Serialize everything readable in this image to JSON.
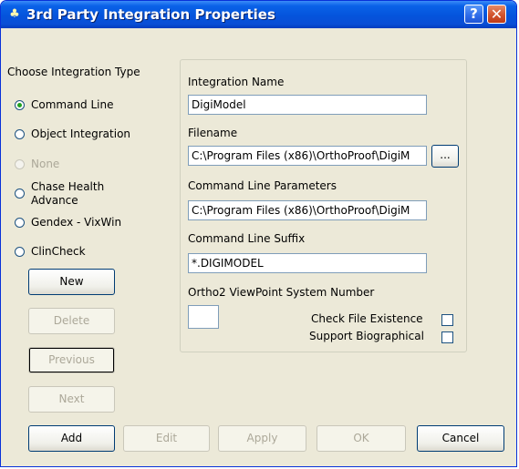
{
  "window": {
    "title": "3rd Party Integration Properties",
    "help_symbol": "?",
    "close_symbol": "✕",
    "title_icon": "integration-app-icon"
  },
  "integration_type": {
    "label": "Choose Integration Type",
    "options": [
      {
        "label": "Command Line",
        "checked": true,
        "enabled": true
      },
      {
        "label": "Object Integration",
        "checked": false,
        "enabled": true
      },
      {
        "label": "None",
        "checked": false,
        "enabled": false
      },
      {
        "label": "Chase Health\nAdvance",
        "line1": "Chase Health",
        "line2": "Advance",
        "checked": false,
        "enabled": true
      },
      {
        "label": "Gendex - VixWin",
        "checked": false,
        "enabled": true
      },
      {
        "label": "ClinCheck",
        "checked": false,
        "enabled": true
      }
    ]
  },
  "side_buttons": {
    "new": "New",
    "delete": "Delete",
    "previous": "Previous",
    "next": "Next"
  },
  "details": {
    "integration_name_label": "Integration Name",
    "integration_name_value": "DigiModel",
    "filename_label": "Filename",
    "filename_value": "C:\\Program Files (x86)\\OrthoProof\\DigiM",
    "browse_label": "...",
    "params_label": "Command Line Parameters",
    "params_value": "C:\\Program Files (x86)\\OrthoProof\\DigiM",
    "suffix_label": "Command Line Suffix",
    "suffix_value": "*.DIGIMODEL",
    "viewpoint_label": "Ortho2 ViewPoint System Number",
    "viewpoint_value": "",
    "check_file_label": "Check File Existence",
    "check_file_checked": false,
    "support_bio_label": "Support Biographical",
    "support_bio_checked": false
  },
  "bottom_buttons": {
    "add": "Add",
    "edit": "Edit",
    "apply": "Apply",
    "ok": "OK",
    "cancel": "Cancel"
  },
  "colors": {
    "titlebar": "#0454dc",
    "dialog_bg": "#ece9d8",
    "radio_dot": "#21a121",
    "disabled_text": "#aca899"
  }
}
